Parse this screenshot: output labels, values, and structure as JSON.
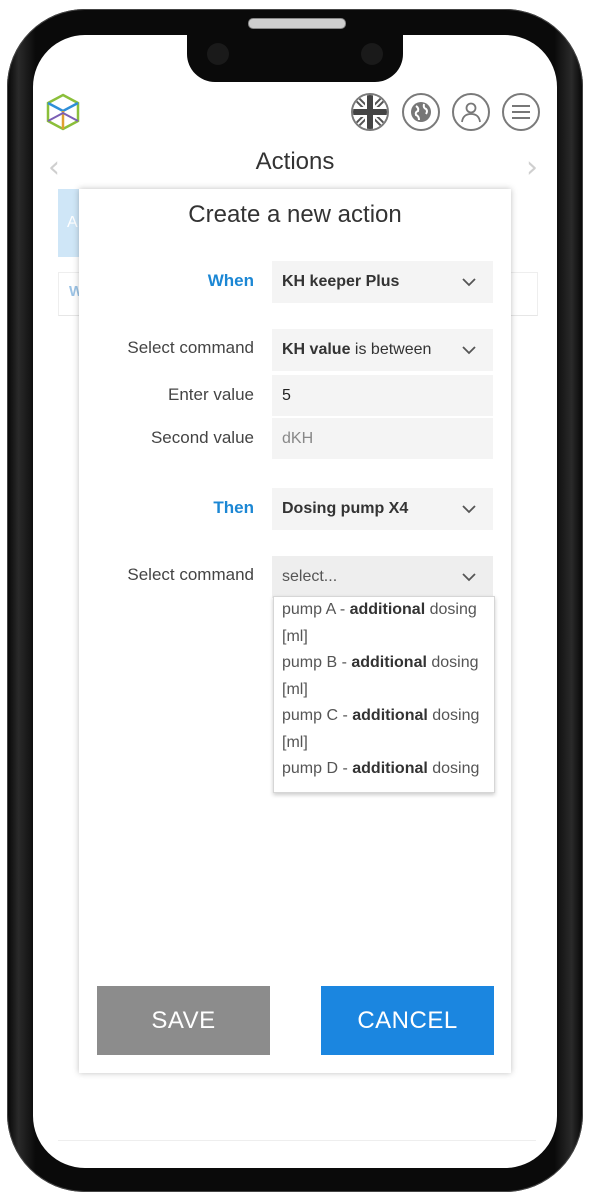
{
  "header": {
    "title": "Actions",
    "icons": [
      "uk-flag-icon",
      "globe-icon",
      "user-icon",
      "menu-icon"
    ]
  },
  "background": {
    "tab_letter": "A",
    "card_letter": "W"
  },
  "modal": {
    "title": "Create a new action",
    "when": {
      "label": "When",
      "value": "KH keeper Plus"
    },
    "condition": {
      "label": "Select command",
      "value_bold": "KH value",
      "value_rest": " is between"
    },
    "enter_value": {
      "label": "Enter value",
      "value": "5"
    },
    "second_value": {
      "label": "Second value",
      "placeholder": "dKH"
    },
    "then": {
      "label": "Then",
      "value": "Dosing pump X4"
    },
    "then_command": {
      "label": "Select command",
      "placeholder": "select..."
    },
    "options": [
      {
        "pre": "pump A - ",
        "bold": "additional",
        "post": " dosing [ml]"
      },
      {
        "pre": "pump B - ",
        "bold": "additional",
        "post": " dosing [ml]"
      },
      {
        "pre": "pump C - ",
        "bold": "additional",
        "post": " dosing [ml]"
      },
      {
        "pre": "pump D - ",
        "bold": "additional",
        "post": " dosing"
      }
    ],
    "save_label": "SAVE",
    "cancel_label": "CANCEL"
  },
  "colors": {
    "accent": "#1b86e0",
    "label_blue": "#1c87d4",
    "save_bg": "#8c8c8c"
  }
}
